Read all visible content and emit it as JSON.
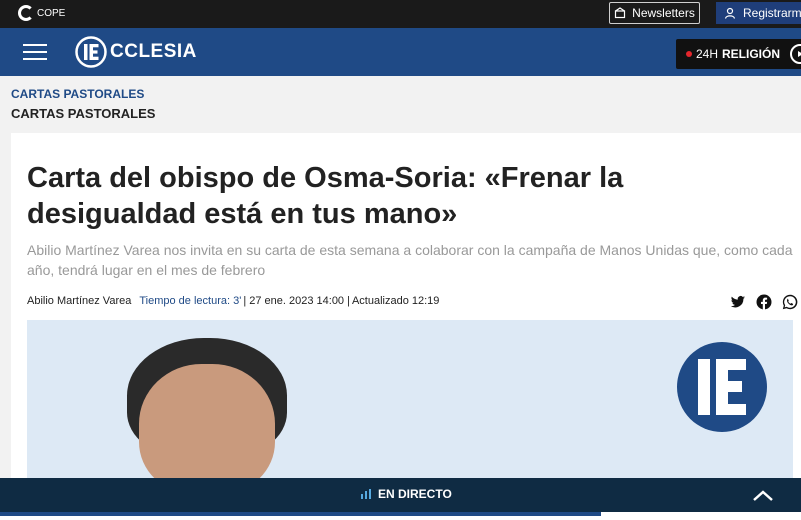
{
  "topbar": {
    "brand": "COPE",
    "newsletters_label": "Newsletters",
    "register_label": "Registrarme"
  },
  "navbar": {
    "logo_text": "CCLESIA",
    "live_prefix": "24H",
    "live_label": "RELIGIÓN"
  },
  "breadcrumb": {
    "section": "CARTAS PASTORALES",
    "title": "CARTAS PASTORALES"
  },
  "article": {
    "headline": "Carta del obispo de Osma-Soria: «Frenar la desigualdad está en tus mano»",
    "subtitle": "Abilio Martínez Varea nos invita en su carta de esta semana a colaborar con la campaña de Manos Unidas que, como cada año, tendrá lugar en el mes de febrero",
    "author": "Abilio Martínez Varea",
    "reading_time": "Tiempo de lectura: 3'",
    "published": "| 27 ene. 2023 14:00 |",
    "updated": "Actualizado 12:19"
  },
  "share_icons": [
    "twitter-icon",
    "facebook-icon",
    "whatsapp-icon"
  ],
  "livebar": {
    "label": "EN DIRECTO",
    "progress": 0.75
  },
  "colors": {
    "brand_blue": "#1f4a86",
    "dark": "#1a1a1a",
    "live_red": "#e3262c",
    "livebar_bg": "#0f2b43"
  }
}
